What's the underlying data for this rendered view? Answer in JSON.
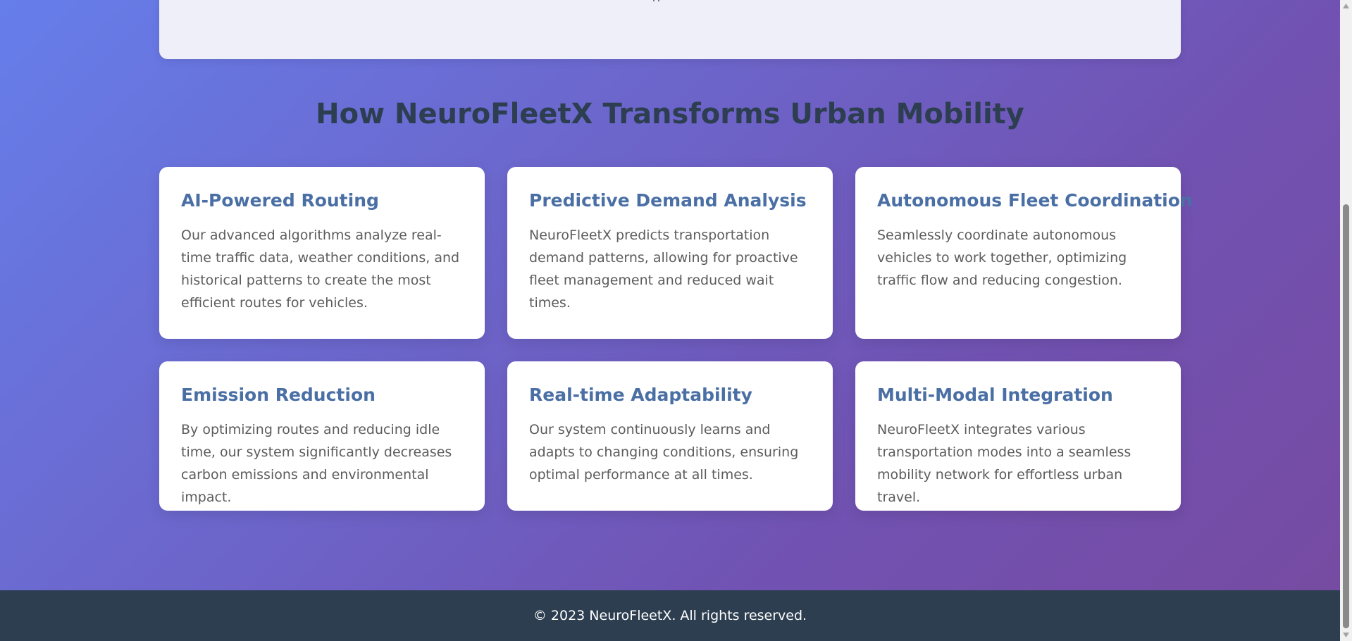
{
  "features": {
    "title": "How NeuroFleetX Transforms Urban Mobility",
    "cards": [
      {
        "title": "AI-Powered Routing",
        "text": "Our advanced algorithms analyze real-time traffic data, weather conditions, and historical patterns to create the most efficient routes for vehicles."
      },
      {
        "title": "Predictive Demand Analysis",
        "text": "NeuroFleetX predicts transportation demand patterns, allowing for proactive fleet management and reduced wait times."
      },
      {
        "title": "Autonomous Fleet Coordination",
        "text": "Seamlessly coordinate autonomous vehicles to work together, optimizing traffic flow and reducing congestion."
      },
      {
        "title": "Emission Reduction",
        "text": "By optimizing routes and reducing idle time, our system significantly decreases carbon emissions and environmental impact."
      },
      {
        "title": "Real-time Adaptability",
        "text": "Our system continuously learns and adapts to changing conditions, ensuring optimal performance at all times."
      },
      {
        "title": "Multi-Modal Integration",
        "text": "NeuroFleetX integrates various transportation modes into a seamless mobility network for effortless urban travel."
      }
    ]
  },
  "footer": {
    "text": "© 2023 NeuroFleetX. All rights reserved."
  },
  "colors": {
    "gradient_start": "#667eea",
    "gradient_end": "#764ba2",
    "heading": "#2c3e50",
    "card_title": "#4a6fa5",
    "footer_bg": "#2c3e50"
  },
  "icons": {
    "scroll_up": "scroll-up-arrow-icon",
    "scroll_down": "scroll-down-arrow-icon"
  }
}
